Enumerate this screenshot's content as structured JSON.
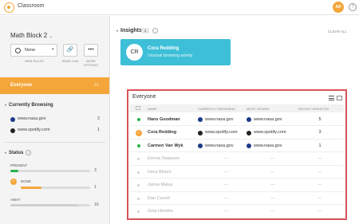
{
  "app": {
    "title": "Classroom",
    "user_initials": "AR"
  },
  "sidebar": {
    "block_title": "Math Block 2",
    "web_rules": {
      "value": "None",
      "caption": "WEB RULES"
    },
    "send_link_caption": "SEND LINK",
    "more_options_caption": "MORE OPTIONS",
    "everyone": {
      "label": "Everyone",
      "count": "10"
    },
    "currently_browsing": {
      "heading": "Currently Browsing",
      "items": [
        {
          "site": "www.nasa.gov",
          "count": "2"
        },
        {
          "site": "www.spotify.com",
          "count": "1"
        }
      ]
    },
    "status": {
      "heading": "Status",
      "present": {
        "label": "PRESENT",
        "count": "3",
        "fraction": 0.1
      },
      "done": {
        "label": "DONE",
        "count": "1",
        "fraction": 0.3
      },
      "away": {
        "label": "AWAY",
        "count": "10",
        "fraction": 0.85
      }
    }
  },
  "insights": {
    "heading": "Insights",
    "count": "1",
    "clear_all": "CLEAR ALL",
    "card": {
      "initials": "CR",
      "name": "Cora Redding",
      "description": "Unusual browsing activity"
    }
  },
  "panel": {
    "title": "Everyone",
    "columns": {
      "name": "NAME",
      "current": "CURRENTLY BROWSING",
      "most_viewed": "MOST VIEWED",
      "recent": "RECENT WEBSITES"
    },
    "students": [
      {
        "name": "Hans Goodman",
        "status": "online",
        "current": "www.nasa.gov",
        "most_viewed": "www.nasa.gov",
        "recent": "5"
      },
      {
        "name": "Cora Redding",
        "status": "done",
        "current": "www.spotify.com",
        "most_viewed": "www.spotify.com",
        "recent": "3"
      },
      {
        "name": "Carmen Van Wyk",
        "status": "online",
        "current": "www.nasa.gov",
        "most_viewed": "www.nasa.gov",
        "recent": "1"
      },
      {
        "name": "Emma Swanson",
        "status": "offline",
        "placeholder": "—"
      },
      {
        "name": "Irena Bloom",
        "status": "offline",
        "placeholder": "—"
      },
      {
        "name": "Janna Matus",
        "status": "offline",
        "placeholder": "—"
      },
      {
        "name": "Dan Carroll",
        "status": "offline",
        "placeholder": "—"
      },
      {
        "name": "Gina Hendrix",
        "status": "offline",
        "placeholder": "—"
      }
    ]
  },
  "colors": {
    "accent": "#f4a63a",
    "online": "#27b24a",
    "insight": "#3dbfd8",
    "highlight_border": "#d9545a"
  }
}
